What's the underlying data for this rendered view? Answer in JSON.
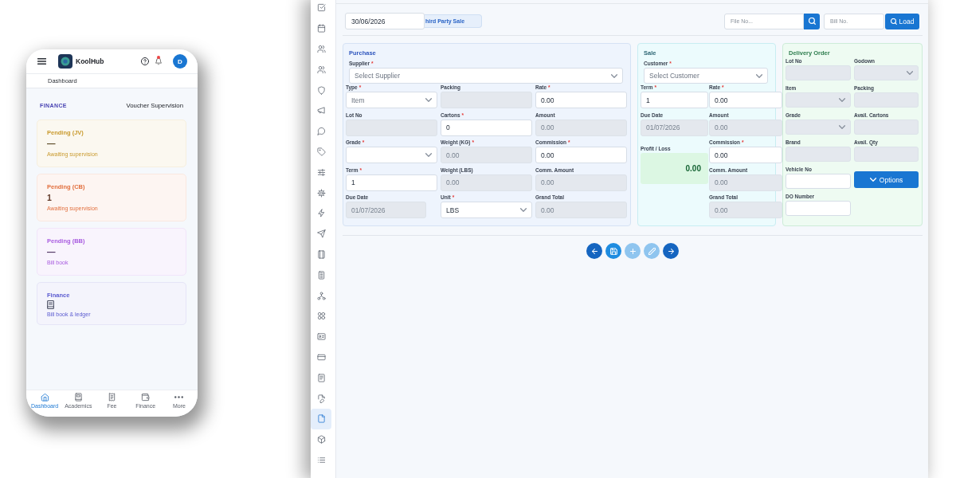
{
  "phone": {
    "header": {
      "app_name": "KoolHub",
      "avatar": "D",
      "unread": true
    },
    "breadcrumb": "Dashboard",
    "section_label": "FINANCE",
    "page_title": "Voucher Supervision",
    "cards": [
      {
        "kind": "stat",
        "title": "Pending (JV)",
        "value": "—",
        "caption": "Awaiting supervision",
        "color": "#c99a2e"
      },
      {
        "kind": "stat",
        "title": "Pending (CB)",
        "value": "1",
        "caption": "Awaiting supervision",
        "color": "#e2703f"
      },
      {
        "kind": "stat",
        "title": "Pending (BB)",
        "value": "—",
        "caption": "Bill book",
        "color": "#a95ce0"
      },
      {
        "kind": "link",
        "title": "Finance",
        "caption": "Bill book & ledger",
        "color": "#5b5bd0"
      }
    ],
    "bottom_nav": [
      {
        "label": "Dashboard",
        "selected": true
      },
      {
        "label": "Academics",
        "selected": false
      },
      {
        "label": "Fee",
        "selected": false
      },
      {
        "label": "Finance",
        "selected": false
      },
      {
        "label": "More",
        "selected": false
      }
    ]
  },
  "desktop": {
    "sidebar": {
      "items": [
        {
          "selected": false
        },
        {
          "selected": false
        },
        {
          "selected": false
        },
        {
          "selected": false
        },
        {
          "selected": false
        },
        {
          "selected": false
        },
        {
          "selected": false
        },
        {
          "selected": false
        },
        {
          "selected": false
        },
        {
          "selected": false
        },
        {
          "selected": false
        },
        {
          "selected": false
        },
        {
          "selected": false
        },
        {
          "selected": false
        },
        {
          "selected": false
        },
        {
          "selected": false
        },
        {
          "selected": false
        },
        {
          "selected": false
        },
        {
          "selected": false
        },
        {
          "selected": false
        },
        {
          "selected": true
        },
        {
          "selected": false
        },
        {
          "selected": false
        }
      ]
    },
    "toolbar": {
      "date": "30/06/2026",
      "tab": {
        "label": "hird Party Sale",
        "selected": true
      },
      "file_search": {
        "placeholder": "File No..."
      },
      "bill_search": {
        "placeholder": "Bill No."
      },
      "load_button": "Load"
    },
    "panels": [
      {
        "kind": "purchase",
        "title": "Purchase",
        "party": {
          "label": "Supplier",
          "required_mark": "*",
          "placeholder": "Select Supplier"
        },
        "columns": [
          [
            {
              "kind": "select",
              "label": "Type",
              "required_mark": "*",
              "placeholder": "Item",
              "disabled": false
            },
            {
              "kind": "input",
              "label": "Lot No",
              "disabled": true
            },
            {
              "kind": "select",
              "label": "Grade",
              "required_mark": "*",
              "disabled": false
            },
            {
              "kind": "input",
              "label": "Term",
              "required_mark": "*",
              "value": "1",
              "disabled": false
            },
            {
              "kind": "date",
              "label": "Due Date",
              "value": "01/07/2026",
              "disabled": true
            }
          ],
          [
            {
              "kind": "input",
              "label": "Packing",
              "disabled": true
            },
            {
              "kind": "input",
              "label": "Cartons",
              "required_mark": "*",
              "value": "0",
              "disabled": false
            },
            {
              "kind": "input",
              "label": "Weight (KG)",
              "required_mark": "*",
              "value": "0.00",
              "disabled": true
            },
            {
              "kind": "input",
              "label": "Weight (LBS)",
              "value": "0.00",
              "disabled": true
            },
            {
              "kind": "select",
              "label": "Unit",
              "required_mark": "*",
              "value": "LBS",
              "disabled": false
            }
          ],
          [
            {
              "kind": "input",
              "label": "Rate",
              "required_mark": "*",
              "value": "0.00",
              "disabled": false
            },
            {
              "kind": "input",
              "label": "Amount",
              "value": "0.00",
              "disabled": true
            },
            {
              "kind": "input",
              "label": "Commission",
              "required_mark": "*",
              "value": "0.00",
              "disabled": false
            },
            {
              "kind": "input",
              "label": "Comm. Amount",
              "value": "0.00",
              "disabled": true
            },
            {
              "kind": "input",
              "label": "Grand Total",
              "value": "0.00",
              "disabled": true
            }
          ]
        ]
      },
      {
        "kind": "sale",
        "title": "Sale",
        "party": {
          "label": "Customer",
          "required_mark": "*",
          "placeholder": "Select Customer"
        },
        "columns": [
          [
            {
              "kind": "input",
              "label": "Term",
              "required_mark": "*",
              "value": "1",
              "disabled": false
            },
            {
              "kind": "date",
              "label": "Due Date",
              "value": "01/07/2026",
              "disabled": true
            },
            {
              "kind": "result",
              "label": "Profit / Loss",
              "value": "0.00"
            }
          ],
          [
            {
              "kind": "input",
              "label": "Rate",
              "required_mark": "*",
              "value": "0.00",
              "disabled": false
            },
            {
              "kind": "input",
              "label": "Amount",
              "value": "0.00",
              "disabled": true
            },
            {
              "kind": "input",
              "label": "Commission",
              "required_mark": "*",
              "value": "0.00",
              "disabled": false
            },
            {
              "kind": "input",
              "label": "Comm. Amount",
              "value": "0.00",
              "disabled": true
            },
            {
              "kind": "input",
              "label": "Grand Total",
              "value": "0.00",
              "disabled": true
            }
          ]
        ]
      },
      {
        "kind": "delivery",
        "title": "Delivery Order",
        "columns": [
          [
            {
              "kind": "input",
              "label": "Lot No",
              "disabled": true
            },
            {
              "kind": "select",
              "label": "Item",
              "disabled": true
            },
            {
              "kind": "select",
              "label": "Grade",
              "disabled": true
            },
            {
              "kind": "input",
              "label": "Brand",
              "disabled": true
            },
            {
              "kind": "input",
              "label": "Vehicle No",
              "disabled": false
            },
            {
              "kind": "input",
              "label": "DO Number",
              "disabled": false
            }
          ],
          [
            {
              "kind": "select",
              "label": "Godown",
              "disabled": true
            },
            {
              "kind": "input",
              "label": "Packing",
              "disabled": true
            },
            {
              "kind": "input",
              "label": "Avail. Cartons",
              "disabled": true
            },
            {
              "kind": "input",
              "label": "Avail. Qty",
              "disabled": true
            },
            {
              "kind": "button",
              "label": "Options",
              "disabled": false
            }
          ]
        ]
      }
    ],
    "actions": [
      {
        "kind": "back",
        "disabled": false
      },
      {
        "kind": "save",
        "disabled": false
      },
      {
        "kind": "add",
        "disabled": true
      },
      {
        "kind": "edit",
        "disabled": true
      },
      {
        "kind": "next",
        "disabled": false
      }
    ]
  }
}
